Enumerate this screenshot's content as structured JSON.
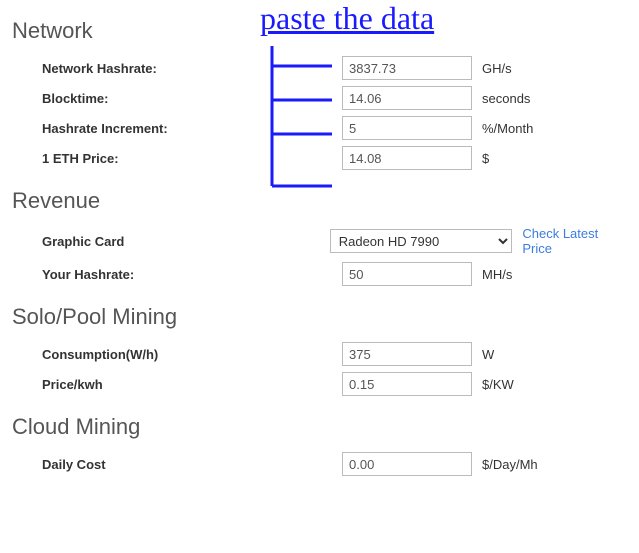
{
  "annotation": {
    "text": "paste the data"
  },
  "network": {
    "title": "Network",
    "hashrate": {
      "label": "Network Hashrate:",
      "value": "3837.73",
      "unit": "GH/s"
    },
    "blocktime": {
      "label": "Blocktime:",
      "value": "14.06",
      "unit": "seconds"
    },
    "increment": {
      "label": "Hashrate Increment:",
      "value": "5",
      "unit": "%/Month"
    },
    "eth_price": {
      "label": "1 ETH Price:",
      "value": "14.08",
      "unit": "$"
    }
  },
  "revenue": {
    "title": "Revenue",
    "gpu": {
      "label": "Graphic Card",
      "selected": "Radeon HD 7990",
      "link": "Check Latest Price"
    },
    "hashrate": {
      "label": "Your Hashrate:",
      "value": "50",
      "unit": "MH/s"
    }
  },
  "solo_pool": {
    "title": "Solo/Pool Mining",
    "consumption": {
      "label": "Consumption(W/h)",
      "value": "375",
      "unit": "W"
    },
    "price_kwh": {
      "label": "Price/kwh",
      "value": "0.15",
      "unit": "$/KW"
    }
  },
  "cloud": {
    "title": "Cloud Mining",
    "daily_cost": {
      "label": "Daily Cost",
      "value": "0.00",
      "unit": "$/Day/Mh"
    }
  }
}
